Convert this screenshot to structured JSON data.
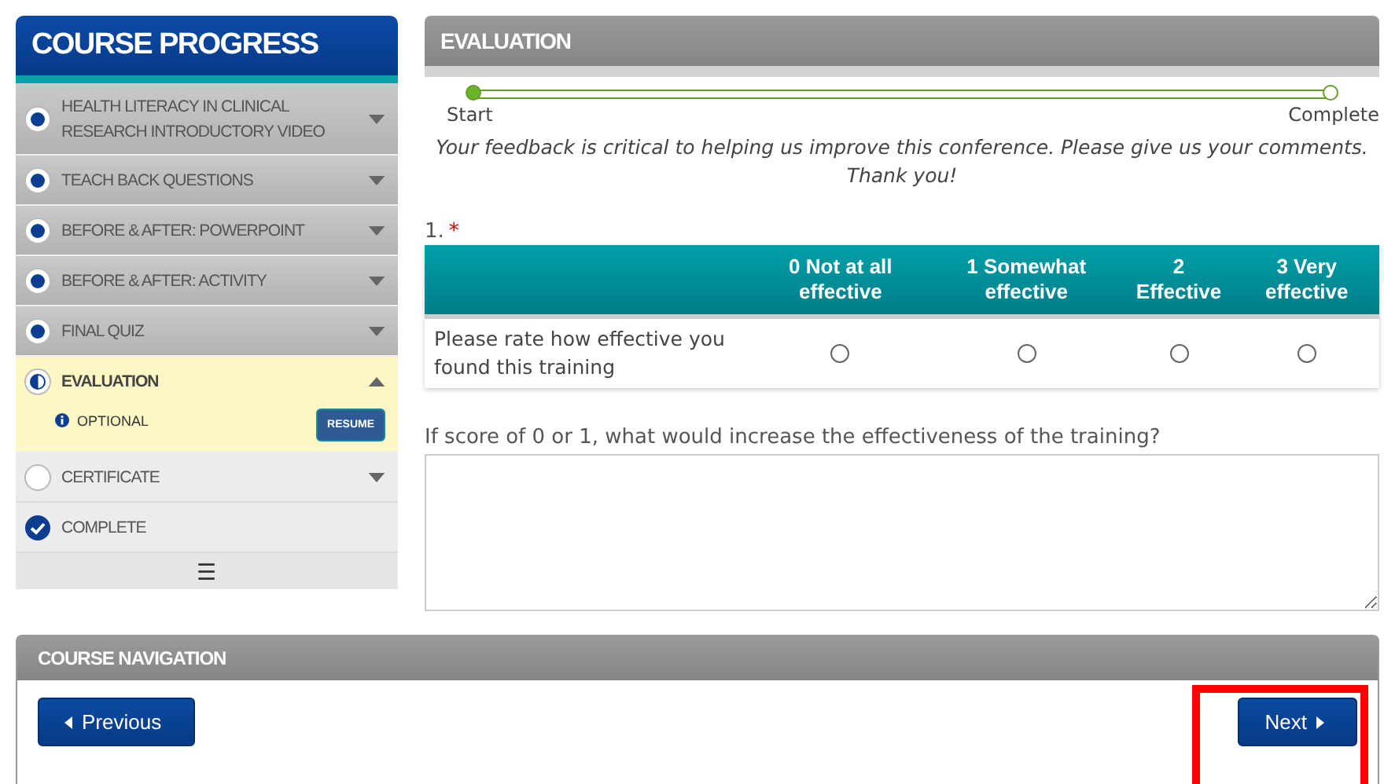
{
  "sidebar": {
    "title": "COURSE PROGRESS",
    "items": [
      {
        "label": "HEALTH LITERACY IN CLINICAL RESEARCH INTRODUCTORY VIDEO",
        "kind": "done",
        "expanded": false,
        "selected": false
      },
      {
        "label": "TEACH BACK QUESTIONS",
        "kind": "done",
        "expanded": false,
        "selected": false
      },
      {
        "label": "BEFORE & AFTER: POWERPOINT",
        "kind": "done",
        "expanded": false,
        "selected": false
      },
      {
        "label": "BEFORE & AFTER: ACTIVITY",
        "kind": "done",
        "expanded": false,
        "selected": false
      },
      {
        "label": "FINAL QUIZ",
        "kind": "done",
        "expanded": false,
        "selected": false
      },
      {
        "label": "EVALUATION",
        "kind": "partial",
        "expanded": true,
        "selected": true,
        "note": "OPTIONAL",
        "action": "RESUME"
      },
      {
        "label": "CERTIFICATE",
        "kind": "empty",
        "expanded": false,
        "selected": false
      },
      {
        "label": "COMPLETE",
        "kind": "check",
        "selected": false
      }
    ],
    "menu_glyph": "☰"
  },
  "evaluation": {
    "title": "EVALUATION",
    "progress": {
      "start": "Start",
      "end": "Complete"
    },
    "intro": "Your feedback is critical to helping us improve this conference. Please give us your comments. Thank you!",
    "question": {
      "number": "1.",
      "required_mark": "*",
      "columns": [
        "0 Not at all effective",
        "1 Somewhat effective",
        "2 Effective",
        "3 Very effective"
      ],
      "rows": [
        {
          "label": "Please rate how effective you found this training",
          "choices": [
            {
              "selected": false
            },
            {
              "selected": false
            },
            {
              "selected": false
            },
            {
              "selected": false
            }
          ]
        }
      ]
    },
    "followup": {
      "label": "If score of 0 or 1, what would increase the effectiveness of the training?"
    }
  },
  "navigation": {
    "title": "COURSE NAVIGATION",
    "previous": "Previous",
    "next": "Next",
    "next_highlighted": true
  }
}
